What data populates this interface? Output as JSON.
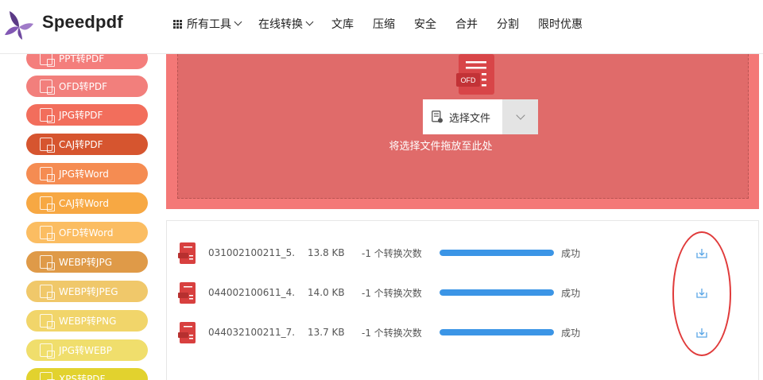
{
  "brand": {
    "name": "Speedpdf"
  },
  "nav": {
    "items": [
      {
        "label": "所有工具",
        "has_grid_icon": true,
        "has_caret": true
      },
      {
        "label": "在线转换",
        "has_caret": true
      },
      {
        "label": "文库"
      },
      {
        "label": "压缩"
      },
      {
        "label": "安全"
      },
      {
        "label": "合并"
      },
      {
        "label": "分割"
      },
      {
        "label": "限时优惠"
      }
    ]
  },
  "sidebar": {
    "items": [
      {
        "label": "PPT转PDF",
        "color": "#f47e7c"
      },
      {
        "label": "OFD转PDF",
        "color": "#f27f7c"
      },
      {
        "label": "JPG转PDF",
        "color": "#f26e5c"
      },
      {
        "label": "CAJ转PDF",
        "color": "#d6552f"
      },
      {
        "label": "JPG转Word",
        "color": "#f58c52"
      },
      {
        "label": "CAJ转Word",
        "color": "#f7a843"
      },
      {
        "label": "OFD转Word",
        "color": "#fbbd62"
      },
      {
        "label": "WEBP转JPG",
        "color": "#df9a48"
      },
      {
        "label": "WEBP转JPEG",
        "color": "#f0c86a"
      },
      {
        "label": "WEBP转PNG",
        "color": "#f1d56a"
      },
      {
        "label": "JPG转WEBP",
        "color": "#f0de6c"
      },
      {
        "label": "XPS转PDF",
        "color": "#e2d22e"
      }
    ]
  },
  "upload": {
    "file_type_badge": "OFD",
    "choose_label": "选择文件",
    "drop_hint": "将选择文件拖放至此处",
    "colors": {
      "outer": "#f47877",
      "inner": "#e06b6a",
      "icon": "#d84548"
    }
  },
  "files": [
    {
      "name": "031002100211_5...",
      "size": "13.8 KB",
      "count": "-1 个转换次数",
      "progress_pct": 100,
      "status": "成功"
    },
    {
      "name": "044002100611_4...",
      "size": "14.0 KB",
      "count": "-1 个转换次数",
      "progress_pct": 100,
      "status": "成功"
    },
    {
      "name": "044032100211_7...",
      "size": "13.7 KB",
      "count": "-1 个转换次数",
      "progress_pct": 100,
      "status": "成功"
    }
  ],
  "colors": {
    "progress": "#3b95e6",
    "highlight_circle": "#e03a3a",
    "download_icon": "#5aa6e6"
  }
}
